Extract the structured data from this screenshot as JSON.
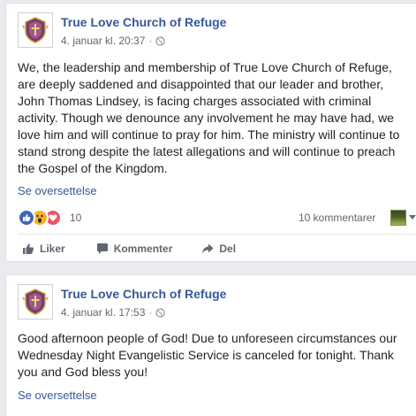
{
  "posts": [
    {
      "page_name": "True Love Church of Refuge",
      "timestamp": "4. januar kl. 20:37",
      "separator": "·",
      "privacy_icon": "globe-icon",
      "text": "We, the leadership and membership of True Love Church of Refuge, are deeply saddened and disappointed that our leader and brother, John Thomas Lindsey, is facing charges associated with criminal activity. Though we denounce any involvement he may have had, we love him and will continue to pray for him. The ministry will continue to stand strong despite the latest allegations and will continue to preach the Gospel of the Kingdom.",
      "see_translation": "Se oversettelse",
      "reactions": {
        "icons": [
          "like-icon",
          "wow-icon",
          "love-icon"
        ],
        "count": "10"
      },
      "comments_count": "10 kommentarer",
      "actions": {
        "like": "Liker",
        "comment": "Kommenter",
        "share": "Del"
      }
    },
    {
      "page_name": "True Love Church of Refuge",
      "timestamp": "4. januar kl. 17:53",
      "separator": "·",
      "privacy_icon": "globe-icon",
      "text": "Good afternoon people of God! Due to unforeseen circumstances our Wednesday Night Evangelistic Service is canceled for tonight. Thank you and God bless you!",
      "see_translation": "Se oversettelse"
    }
  ],
  "colors": {
    "link": "#365899",
    "like": "#4267b2",
    "wow": "#f7b125",
    "love": "#f25268",
    "background": "#e9ebee"
  }
}
